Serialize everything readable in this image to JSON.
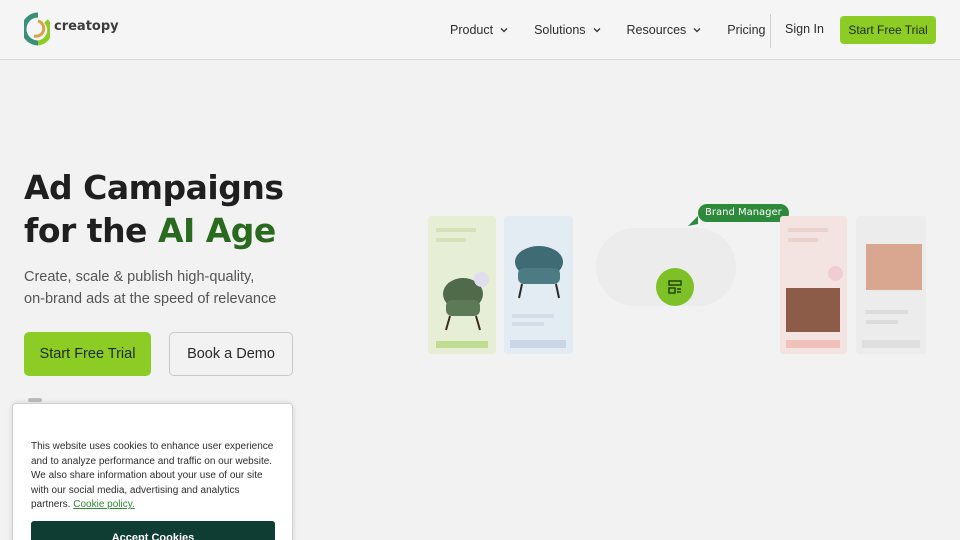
{
  "header": {
    "logo_text": "creatopy",
    "nav": [
      {
        "label": "Product",
        "has_dropdown": true
      },
      {
        "label": "Solutions",
        "has_dropdown": true
      },
      {
        "label": "Resources",
        "has_dropdown": true
      },
      {
        "label": "Pricing",
        "has_dropdown": false
      }
    ],
    "signin_label": "Sign In",
    "cta_label": "Start Free Trial"
  },
  "hero": {
    "title_line1": "Ad Campaigns",
    "title_line2_prefix": "for the ",
    "title_line2_accent": "AI Age",
    "subtitle_line1": "Create, scale & publish high-quality,",
    "subtitle_line2": "on-brand ads at the speed of relevance",
    "primary_cta": "Start Free Trial",
    "secondary_cta": "Book a Demo"
  },
  "illustration": {
    "badge": "Brand Manager",
    "hub_icon": "layout-icon"
  },
  "cookie_banner": {
    "text": "This website uses cookies to enhance user experience and to analyze performance and traffic on our website. We also share information about your use of our site with our social media, advertising and analytics partners.",
    "link_text": "Cookie policy.",
    "accept_label": "Accept Cookies"
  },
  "colors": {
    "brand_green": "#8ccc24",
    "accent_text": "#2a6a1e",
    "cookie_button": "#0f3d33",
    "badge": "#2d8a3a"
  }
}
